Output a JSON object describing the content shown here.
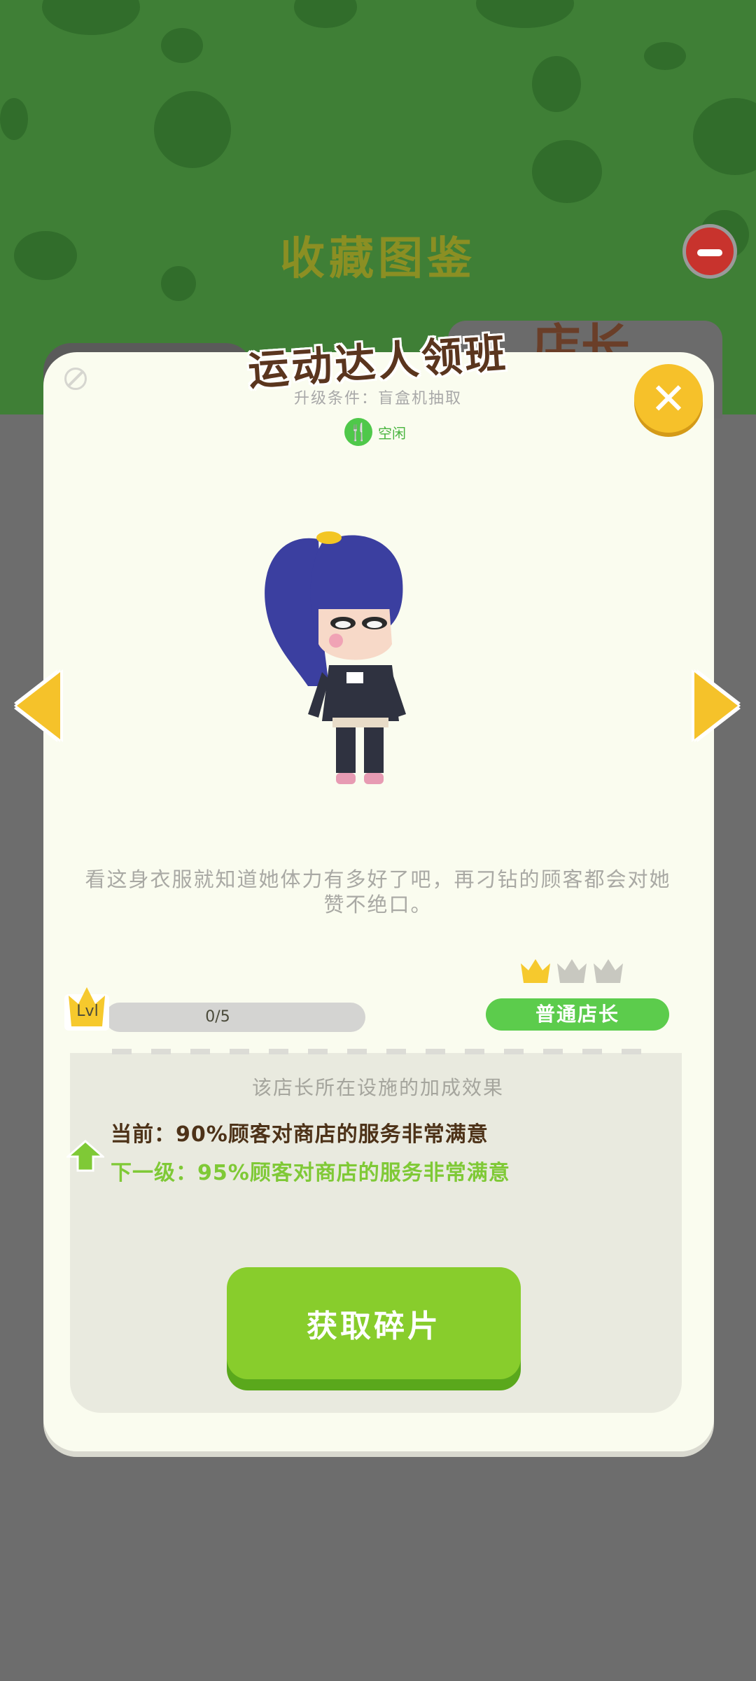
{
  "background": {
    "title": "收藏图鉴",
    "tab_label": "店长"
  },
  "dialog": {
    "title": "运动达人领班",
    "subtitle": "升级条件：盲盒机抽取",
    "status": "空闲",
    "description": "看这身衣服就知道她体力有多好了吧，再刁钻的顾客都会对她赞不绝口。",
    "level_label": "Lvl",
    "progress_text": "0/5",
    "progress_fraction": 0,
    "stars_filled": 1,
    "stars_total": 3,
    "rank": "普通店长",
    "effect_heading": "该店长所在设施的加成效果",
    "effect_current": "当前：90%顾客对商店的服务非常满意",
    "effect_next": "下一级：95%顾客对商店的服务非常满意",
    "action_button": "获取碎片"
  },
  "colors": {
    "accent_green": "#88cd2c",
    "rank_green": "#5ccc4c",
    "gold": "#f5c22a"
  }
}
